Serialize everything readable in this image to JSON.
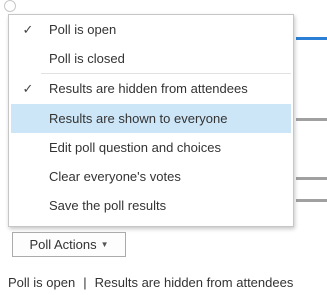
{
  "menu": {
    "items": [
      {
        "label": "Poll is open",
        "checked": true
      },
      {
        "label": "Poll is closed",
        "checked": false
      },
      {
        "label": "Results are hidden from attendees",
        "checked": true
      },
      {
        "label": "Results are shown to everyone",
        "checked": false,
        "highlighted": true
      },
      {
        "label": "Edit poll question and choices",
        "checked": false
      },
      {
        "label": "Clear everyone's votes",
        "checked": false
      },
      {
        "label": "Save the poll results",
        "checked": false
      }
    ],
    "check_glyph": "✓"
  },
  "button": {
    "label": "Poll Actions",
    "caret": "▼"
  },
  "status": {
    "poll_state": "Poll is open",
    "separator": "|",
    "results_state": "Results are hidden from attendees"
  },
  "colors": {
    "highlight": "#cde6f7",
    "accent": "#2b7fd4"
  }
}
